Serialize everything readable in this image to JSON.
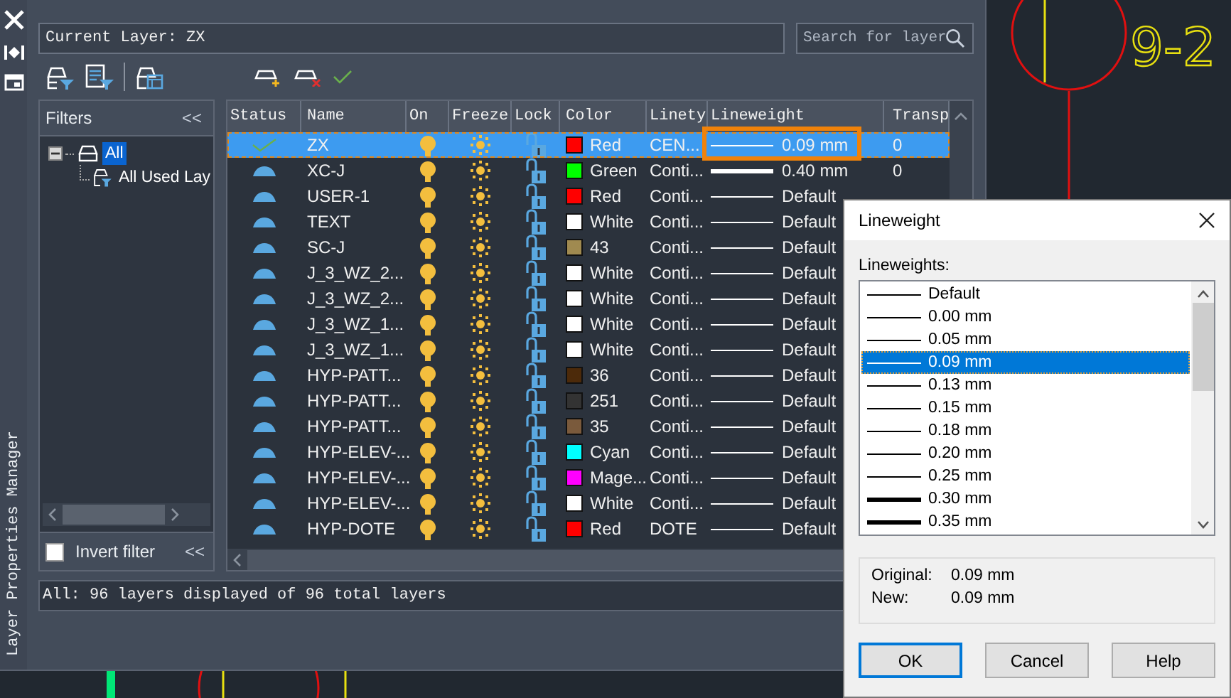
{
  "cad": {
    "labels": [
      {
        "text": "9-2"
      }
    ]
  },
  "palette": {
    "title": "Layer Properties Manager",
    "current_layer": "Current Layer: ZX",
    "search": {
      "placeholder": "Search for layer"
    },
    "filters": {
      "title": "Filters",
      "collapse": "<<",
      "tree": [
        {
          "label": "All",
          "selected": true,
          "expanded": true,
          "children": [
            {
              "label": "All Used Lay",
              "selected": false
            }
          ]
        }
      ],
      "invert_filter": {
        "label": "Invert filter",
        "checked": false
      },
      "collapse_bottom": "<<"
    },
    "table": {
      "columns": [
        "Status",
        "Name",
        "On",
        "Freeze",
        "Lock",
        "Color",
        "Linety",
        "Lineweight",
        "Transp"
      ],
      "rows": [
        {
          "current": true,
          "name": "ZX",
          "on": true,
          "frozen": false,
          "locked": false,
          "color": "#ff0000",
          "color_name": "Red",
          "linetype": "CEN...",
          "lineweight": "0.09 mm",
          "heavy_line": false,
          "transparency": "0",
          "selected": true,
          "highlighted": true
        },
        {
          "current": false,
          "name": "XC-J",
          "on": true,
          "frozen": false,
          "locked": false,
          "color": "#00ff00",
          "color_name": "Green",
          "linetype": "Conti...",
          "lineweight": "0.40 mm",
          "heavy_line": true,
          "transparency": "0",
          "selected": false,
          "highlighted": false
        },
        {
          "current": false,
          "name": "USER-1",
          "on": true,
          "frozen": false,
          "locked": false,
          "color": "#ff0000",
          "color_name": "Red",
          "linetype": "Conti...",
          "lineweight": "Default",
          "heavy_line": false,
          "selected": false,
          "highlighted": false
        },
        {
          "current": false,
          "name": "TEXT",
          "on": true,
          "frozen": false,
          "locked": false,
          "color": "#ffffff",
          "color_name": "White",
          "linetype": "Conti...",
          "lineweight": "Default",
          "heavy_line": false,
          "selected": false,
          "highlighted": false
        },
        {
          "current": false,
          "name": "SC-J",
          "on": true,
          "frozen": false,
          "locked": false,
          "color": "#a08a50",
          "color_name": "43",
          "linetype": "Conti...",
          "lineweight": "Default",
          "heavy_line": false,
          "selected": false,
          "highlighted": false
        },
        {
          "current": false,
          "name": "J_3_WZ_2...",
          "on": true,
          "frozen": false,
          "locked": false,
          "color": "#ffffff",
          "color_name": "White",
          "linetype": "Conti...",
          "lineweight": "Default",
          "heavy_line": false,
          "selected": false,
          "highlighted": false
        },
        {
          "current": false,
          "name": "J_3_WZ_2...",
          "on": true,
          "frozen": false,
          "locked": false,
          "color": "#ffffff",
          "color_name": "White",
          "linetype": "Conti...",
          "lineweight": "Default",
          "heavy_line": false,
          "selected": false,
          "highlighted": false
        },
        {
          "current": false,
          "name": "J_3_WZ_1...",
          "on": true,
          "frozen": false,
          "locked": false,
          "color": "#ffffff",
          "color_name": "White",
          "linetype": "Conti...",
          "lineweight": "Default",
          "heavy_line": false,
          "selected": false,
          "highlighted": false
        },
        {
          "current": false,
          "name": "J_3_WZ_1...",
          "on": true,
          "frozen": false,
          "locked": false,
          "color": "#ffffff",
          "color_name": "White",
          "linetype": "Conti...",
          "lineweight": "Default",
          "heavy_line": false,
          "selected": false,
          "highlighted": false
        },
        {
          "current": false,
          "name": "HYP-PATT...",
          "on": true,
          "frozen": false,
          "locked": false,
          "color": "#4c2a0a",
          "color_name": "36",
          "linetype": "Conti...",
          "lineweight": "Default",
          "heavy_line": false,
          "selected": false,
          "highlighted": false
        },
        {
          "current": false,
          "name": "HYP-PATT...",
          "on": true,
          "frozen": false,
          "locked": false,
          "color": "#333333",
          "color_name": "251",
          "linetype": "Conti...",
          "lineweight": "Default",
          "heavy_line": false,
          "selected": false,
          "highlighted": false
        },
        {
          "current": false,
          "name": "HYP-PATT...",
          "on": true,
          "frozen": false,
          "locked": false,
          "color": "#7a5a3c",
          "color_name": "35",
          "linetype": "Conti...",
          "lineweight": "Default",
          "heavy_line": false,
          "selected": false,
          "highlighted": false
        },
        {
          "current": false,
          "name": "HYP-ELEV-...",
          "on": true,
          "frozen": false,
          "locked": false,
          "color": "#00ffff",
          "color_name": "Cyan",
          "linetype": "Conti...",
          "lineweight": "Default",
          "heavy_line": false,
          "selected": false,
          "highlighted": false
        },
        {
          "current": false,
          "name": "HYP-ELEV-...",
          "on": true,
          "frozen": false,
          "locked": false,
          "color": "#ff00ff",
          "color_name": "Mage...",
          "linetype": "Conti...",
          "lineweight": "Default",
          "heavy_line": false,
          "selected": false,
          "highlighted": false
        },
        {
          "current": false,
          "name": "HYP-ELEV-...",
          "on": true,
          "frozen": false,
          "locked": false,
          "color": "#ffffff",
          "color_name": "White",
          "linetype": "Conti...",
          "lineweight": "Default",
          "heavy_line": false,
          "selected": false,
          "highlighted": false
        },
        {
          "current": false,
          "name": "HYP-DOTE",
          "on": true,
          "frozen": false,
          "locked": false,
          "color": "#ff0000",
          "color_name": "Red",
          "linetype": "DOTE",
          "lineweight": "Default",
          "heavy_line": false,
          "selected": false,
          "highlighted": false
        }
      ]
    },
    "status_bar": "All: 96 layers displayed of 96 total layers"
  },
  "dialog": {
    "title": "Lineweight",
    "list_label": "Lineweights:",
    "options": [
      {
        "label": "Default",
        "heavy": false,
        "selected": false
      },
      {
        "label": "0.00 mm",
        "heavy": false,
        "selected": false
      },
      {
        "label": "0.05 mm",
        "heavy": false,
        "selected": false
      },
      {
        "label": "0.09 mm",
        "heavy": false,
        "selected": true
      },
      {
        "label": "0.13 mm",
        "heavy": false,
        "selected": false
      },
      {
        "label": "0.15 mm",
        "heavy": false,
        "selected": false
      },
      {
        "label": "0.18 mm",
        "heavy": false,
        "selected": false
      },
      {
        "label": "0.20 mm",
        "heavy": false,
        "selected": false
      },
      {
        "label": "0.25 mm",
        "heavy": false,
        "selected": false
      },
      {
        "label": "0.30 mm",
        "heavy": true,
        "selected": false
      },
      {
        "label": "0.35 mm",
        "heavy": true,
        "selected": false
      }
    ],
    "info": [
      {
        "label": "Original:",
        "value": "0.09 mm"
      },
      {
        "label": "New:",
        "value": "0.09 mm"
      }
    ],
    "buttons": [
      {
        "label": "OK",
        "default": true
      },
      {
        "label": "Cancel",
        "default": false
      },
      {
        "label": "Help",
        "default": false
      }
    ]
  }
}
